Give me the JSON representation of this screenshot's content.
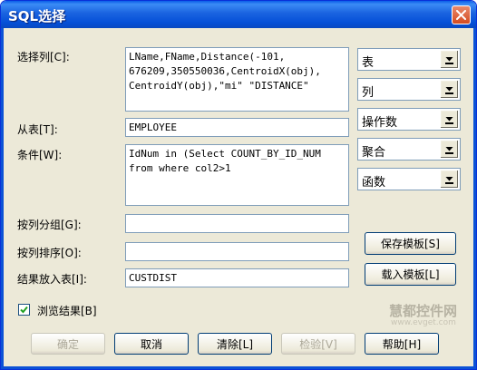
{
  "window": {
    "title": "SQL选择"
  },
  "labels": {
    "select_columns": "选择列[C]:",
    "from_table": "从表[T]:",
    "condition": "条件[W]:",
    "group_by": "按列分组[G]:",
    "order_by": "按列排序[O]:",
    "result_table": "结果放入表[I]:"
  },
  "fields": {
    "select_columns": "LName,FName,Distance(-101,\n676209,350550036,CentroidX(obj),\nCentroidY(obj),\"mi\" \"DISTANCE\"",
    "from_table": "EMPLOYEE",
    "condition": "IdNum in (Select COUNT_BY_ID_NUM\nfrom where col2>1",
    "group_by": "",
    "order_by": "",
    "result_table": "CUSTDIST"
  },
  "combos": {
    "tables": "表",
    "columns": "列",
    "operators": "操作数",
    "aggregates": "聚合",
    "functions": "函数"
  },
  "buttons": {
    "save_template": "保存模板[S]",
    "load_template": "载入模板[L]",
    "ok": "确定",
    "cancel": "取消",
    "clear": "清除[L]",
    "verify": "检验[V]",
    "help": "帮助[H]"
  },
  "checkbox": {
    "browse_results_label": "浏览结果[B]",
    "browse_results_checked": true
  },
  "watermark": {
    "text": "慧都控件网",
    "url": "www.evget.com"
  },
  "colors": {
    "title_bar": "#0a5ee8",
    "dialog_bg": "#ece9d8",
    "close_button": "#d44b20"
  },
  "icons": {
    "close": "close-icon",
    "dropdown": "chevron-down-icon",
    "check": "check-icon"
  }
}
